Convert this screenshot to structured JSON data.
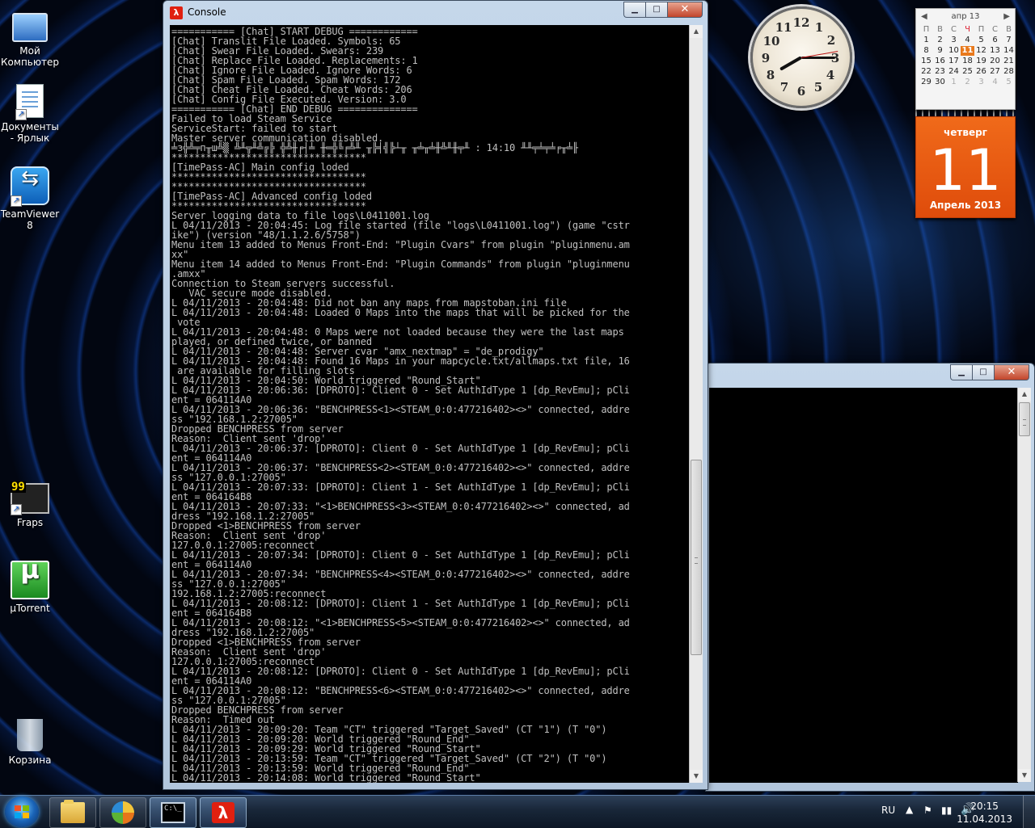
{
  "desktop": {
    "icons": [
      {
        "label": "Мой Компьютер",
        "icon": "computer-icon"
      },
      {
        "label": "Документы - Ярлык",
        "icon": "documents-shortcut-icon"
      },
      {
        "label": "TeamViewer 8",
        "icon": "teamviewer-icon"
      },
      {
        "label": "Fraps",
        "icon": "fraps-icon",
        "badge": "99"
      },
      {
        "label": "µTorrent",
        "icon": "utorrent-icon"
      },
      {
        "label": "Корзина",
        "icon": "recycle-bin-icon"
      }
    ]
  },
  "console_window": {
    "title": "Console",
    "lines": [
      "=========== [Chat] START DEBUG ============",
      "[Chat] Translit File Loaded. Symbols: 65",
      "[Chat] Swear File Loaded. Swears: 239",
      "[Chat] Replace File Loaded. Replacements: 1",
      "[Chat] Ignore File Loaded. Ignore Words: 6",
      "[Chat] Spam File Loaded. Spam Words: 172",
      "[Chat] Cheat File Loaded. Cheat Words: 206",
      "[Chat] Config File Executed. Version: 3.0",
      "=========== [Chat] END DEBUG ==============",
      "Failed to load Steam Service",
      "ServiceStart: failed to start",
      "Master server communication disabled.",
      "╧з╬╩╤п╥ш╩▒ ╩╨╦╨╩╔╠ ╬╩╫╒┤╧ ╫═╬╚╒╩╨ ╥╠╡╣╠┴╥ ╥╧╥╧╫╩╨╫╤╨ : 14:10 ╨╨╤╧╤╧╒╥╧╟",
      "**********************************",
      "[TimePass-AC] Main config loded",
      "**********************************",
      "**********************************",
      "[TimePass-AC] Advanced config loded",
      "**********************************",
      "Server logging data to file logs\\L0411001.log",
      "L 04/11/2013 - 20:04:45: Log file started (file \"logs\\L0411001.log\") (game \"cstr",
      "ike\") (version \"48/1.1.2.6/5758\")",
      "Menu item 13 added to Menus Front-End: \"Plugin Cvars\" from plugin \"pluginmenu.am",
      "xx\"",
      "Menu item 14 added to Menus Front-End: \"Plugin Commands\" from plugin \"pluginmenu",
      ".amxx\"",
      "Connection to Steam servers successful.",
      "   VAC secure mode disabled.",
      "L 04/11/2013 - 20:04:48: Did not ban any maps from mapstoban.ini file",
      "L 04/11/2013 - 20:04:48: Loaded 0 Maps into the maps that will be picked for the",
      " vote",
      "L 04/11/2013 - 20:04:48: 0 Maps were not loaded because they were the last maps",
      "played, or defined twice, or banned",
      "L 04/11/2013 - 20:04:48: Server cvar \"amx_nextmap\" = \"de_prodigy\"",
      "L 04/11/2013 - 20:04:48: Found 16 Maps in your mapcycle.txt/allmaps.txt file, 16",
      " are available for filling slots",
      "L 04/11/2013 - 20:04:50: World triggered \"Round_Start\"",
      "L 04/11/2013 - 20:06:36: [DPROTO]: Client 0 - Set AuthIdType 1 [dp_RevEmu]; pCli",
      "ent = 064114A0",
      "L 04/11/2013 - 20:06:36: \"BENCHPRESS<1><STEAM_0:0:477216402><>\" connected, addre",
      "ss \"192.168.1.2:27005\"",
      "Dropped BENCHPRESS from server",
      "Reason:  Client sent 'drop'",
      "L 04/11/2013 - 20:06:37: [DPROTO]: Client 0 - Set AuthIdType 1 [dp_RevEmu]; pCli",
      "ent = 064114A0",
      "L 04/11/2013 - 20:06:37: \"BENCHPRESS<2><STEAM_0:0:477216402><>\" connected, addre",
      "ss \"127.0.0.1:27005\"",
      "L 04/11/2013 - 20:07:33: [DPROTO]: Client 1 - Set AuthIdType 1 [dp_RevEmu]; pCli",
      "ent = 064164B8",
      "L 04/11/2013 - 20:07:33: \"<1>BENCHPRESS<3><STEAM_0:0:477216402><>\" connected, ad",
      "dress \"192.168.1.2:27005\"",
      "Dropped <1>BENCHPRESS from server",
      "Reason:  Client sent 'drop'",
      "127.0.0.1:27005:reconnect",
      "L 04/11/2013 - 20:07:34: [DPROTO]: Client 0 - Set AuthIdType 1 [dp_RevEmu]; pCli",
      "ent = 064114A0",
      "L 04/11/2013 - 20:07:34: \"BENCHPRESS<4><STEAM_0:0:477216402><>\" connected, addre",
      "ss \"127.0.0.1:27005\"",
      "192.168.1.2:27005:reconnect",
      "L 04/11/2013 - 20:08:12: [DPROTO]: Client 1 - Set AuthIdType 1 [dp_RevEmu]; pCli",
      "ent = 064164B8",
      "L 04/11/2013 - 20:08:12: \"<1>BENCHPRESS<5><STEAM_0:0:477216402><>\" connected, ad",
      "dress \"192.168.1.2:27005\"",
      "Dropped <1>BENCHPRESS from server",
      "Reason:  Client sent 'drop'",
      "127.0.0.1:27005:reconnect",
      "L 04/11/2013 - 20:08:12: [DPROTO]: Client 0 - Set AuthIdType 1 [dp_RevEmu]; pCli",
      "ent = 064114A0",
      "L 04/11/2013 - 20:08:12: \"BENCHPRESS<6><STEAM_0:0:477216402><>\" connected, addre",
      "ss \"127.0.0.1:27005\"",
      "Dropped BENCHPRESS from server",
      "Reason:  Timed out",
      "L 04/11/2013 - 20:09:20: Team \"CT\" triggered \"Target_Saved\" (CT \"1\") (T \"0\")",
      "L 04/11/2013 - 20:09:20: World triggered \"Round_End\"",
      "L 04/11/2013 - 20:09:29: World triggered \"Round_Start\"",
      "L 04/11/2013 - 20:13:59: Team \"CT\" triggered \"Target_Saved\" (CT \"2\") (T \"0\")",
      "L 04/11/2013 - 20:13:59: World triggered \"Round_End\"",
      "L 04/11/2013 - 20:14:08: World triggered \"Round_Start\""
    ]
  },
  "clock_gadget": {
    "numbers": [
      "12",
      "1",
      "2",
      "3",
      "4",
      "5",
      "6",
      "7",
      "8",
      "9",
      "10",
      "11"
    ]
  },
  "calendar_gadget": {
    "month_label": "апр 13",
    "weekdays": [
      "П",
      "В",
      "С",
      "Ч",
      "П",
      "С",
      "В"
    ],
    "weeks": [
      [
        "1",
        "2",
        "3",
        "4",
        "5",
        "6",
        "7"
      ],
      [
        "8",
        "9",
        "10",
        "11",
        "12",
        "13",
        "14"
      ],
      [
        "15",
        "16",
        "17",
        "18",
        "19",
        "20",
        "21"
      ],
      [
        "22",
        "23",
        "24",
        "25",
        "26",
        "27",
        "28"
      ],
      [
        "29",
        "30",
        "1",
        "2",
        "3",
        "4",
        "5"
      ]
    ],
    "weekday_name": "четверг",
    "day": "11",
    "month_year": "Апрель 2013"
  },
  "taskbar": {
    "language": "RU",
    "time": "20:15",
    "date": "11.04.2013"
  },
  "colors": {
    "console_text": "#c0c0c0",
    "calendar_orange": "#e8601a",
    "close_red": "#c2452b"
  }
}
